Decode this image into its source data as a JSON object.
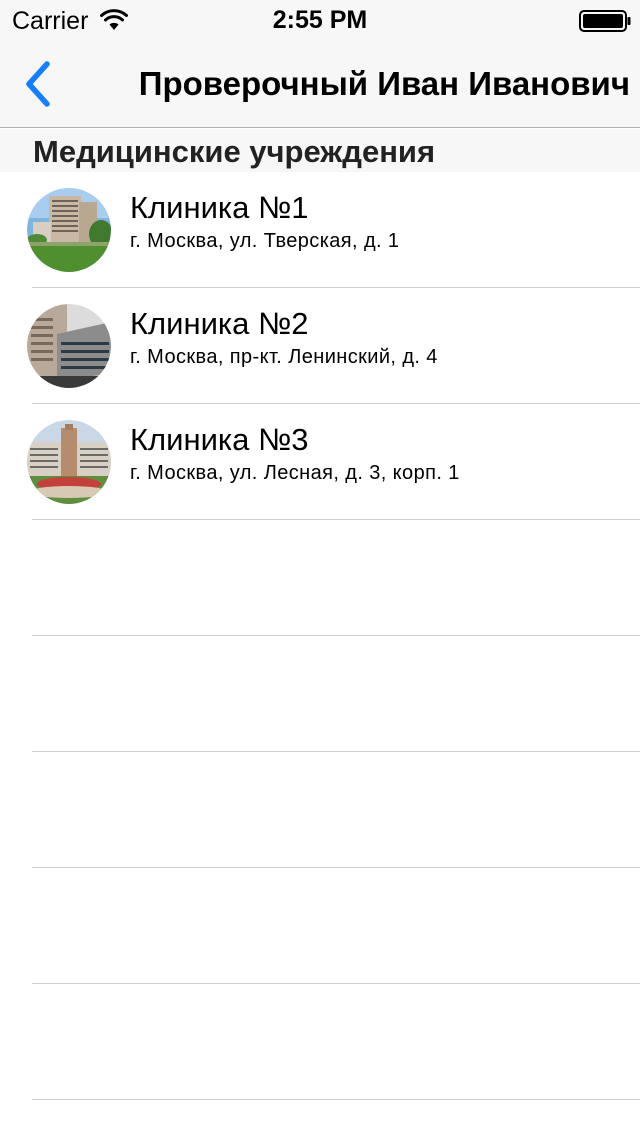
{
  "status_bar": {
    "carrier": "Carrier",
    "time": "2:55 PM"
  },
  "nav": {
    "title": "Проверочный Иван Иванович",
    "back_icon": "chevron-left-icon",
    "accent_color": "#157efb"
  },
  "section": {
    "title": "Медицинские учреждения"
  },
  "clinics": [
    {
      "name": "Клиника №1",
      "address": "г. Москва, ул. Тверская, д. 1"
    },
    {
      "name": "Клиника №2",
      "address": "г. Москва, пр-кт. Ленинский, д. 4"
    },
    {
      "name": "Клиника №3",
      "address": "г. Москва, ул. Лесная, д. 3, корп. 1"
    }
  ]
}
